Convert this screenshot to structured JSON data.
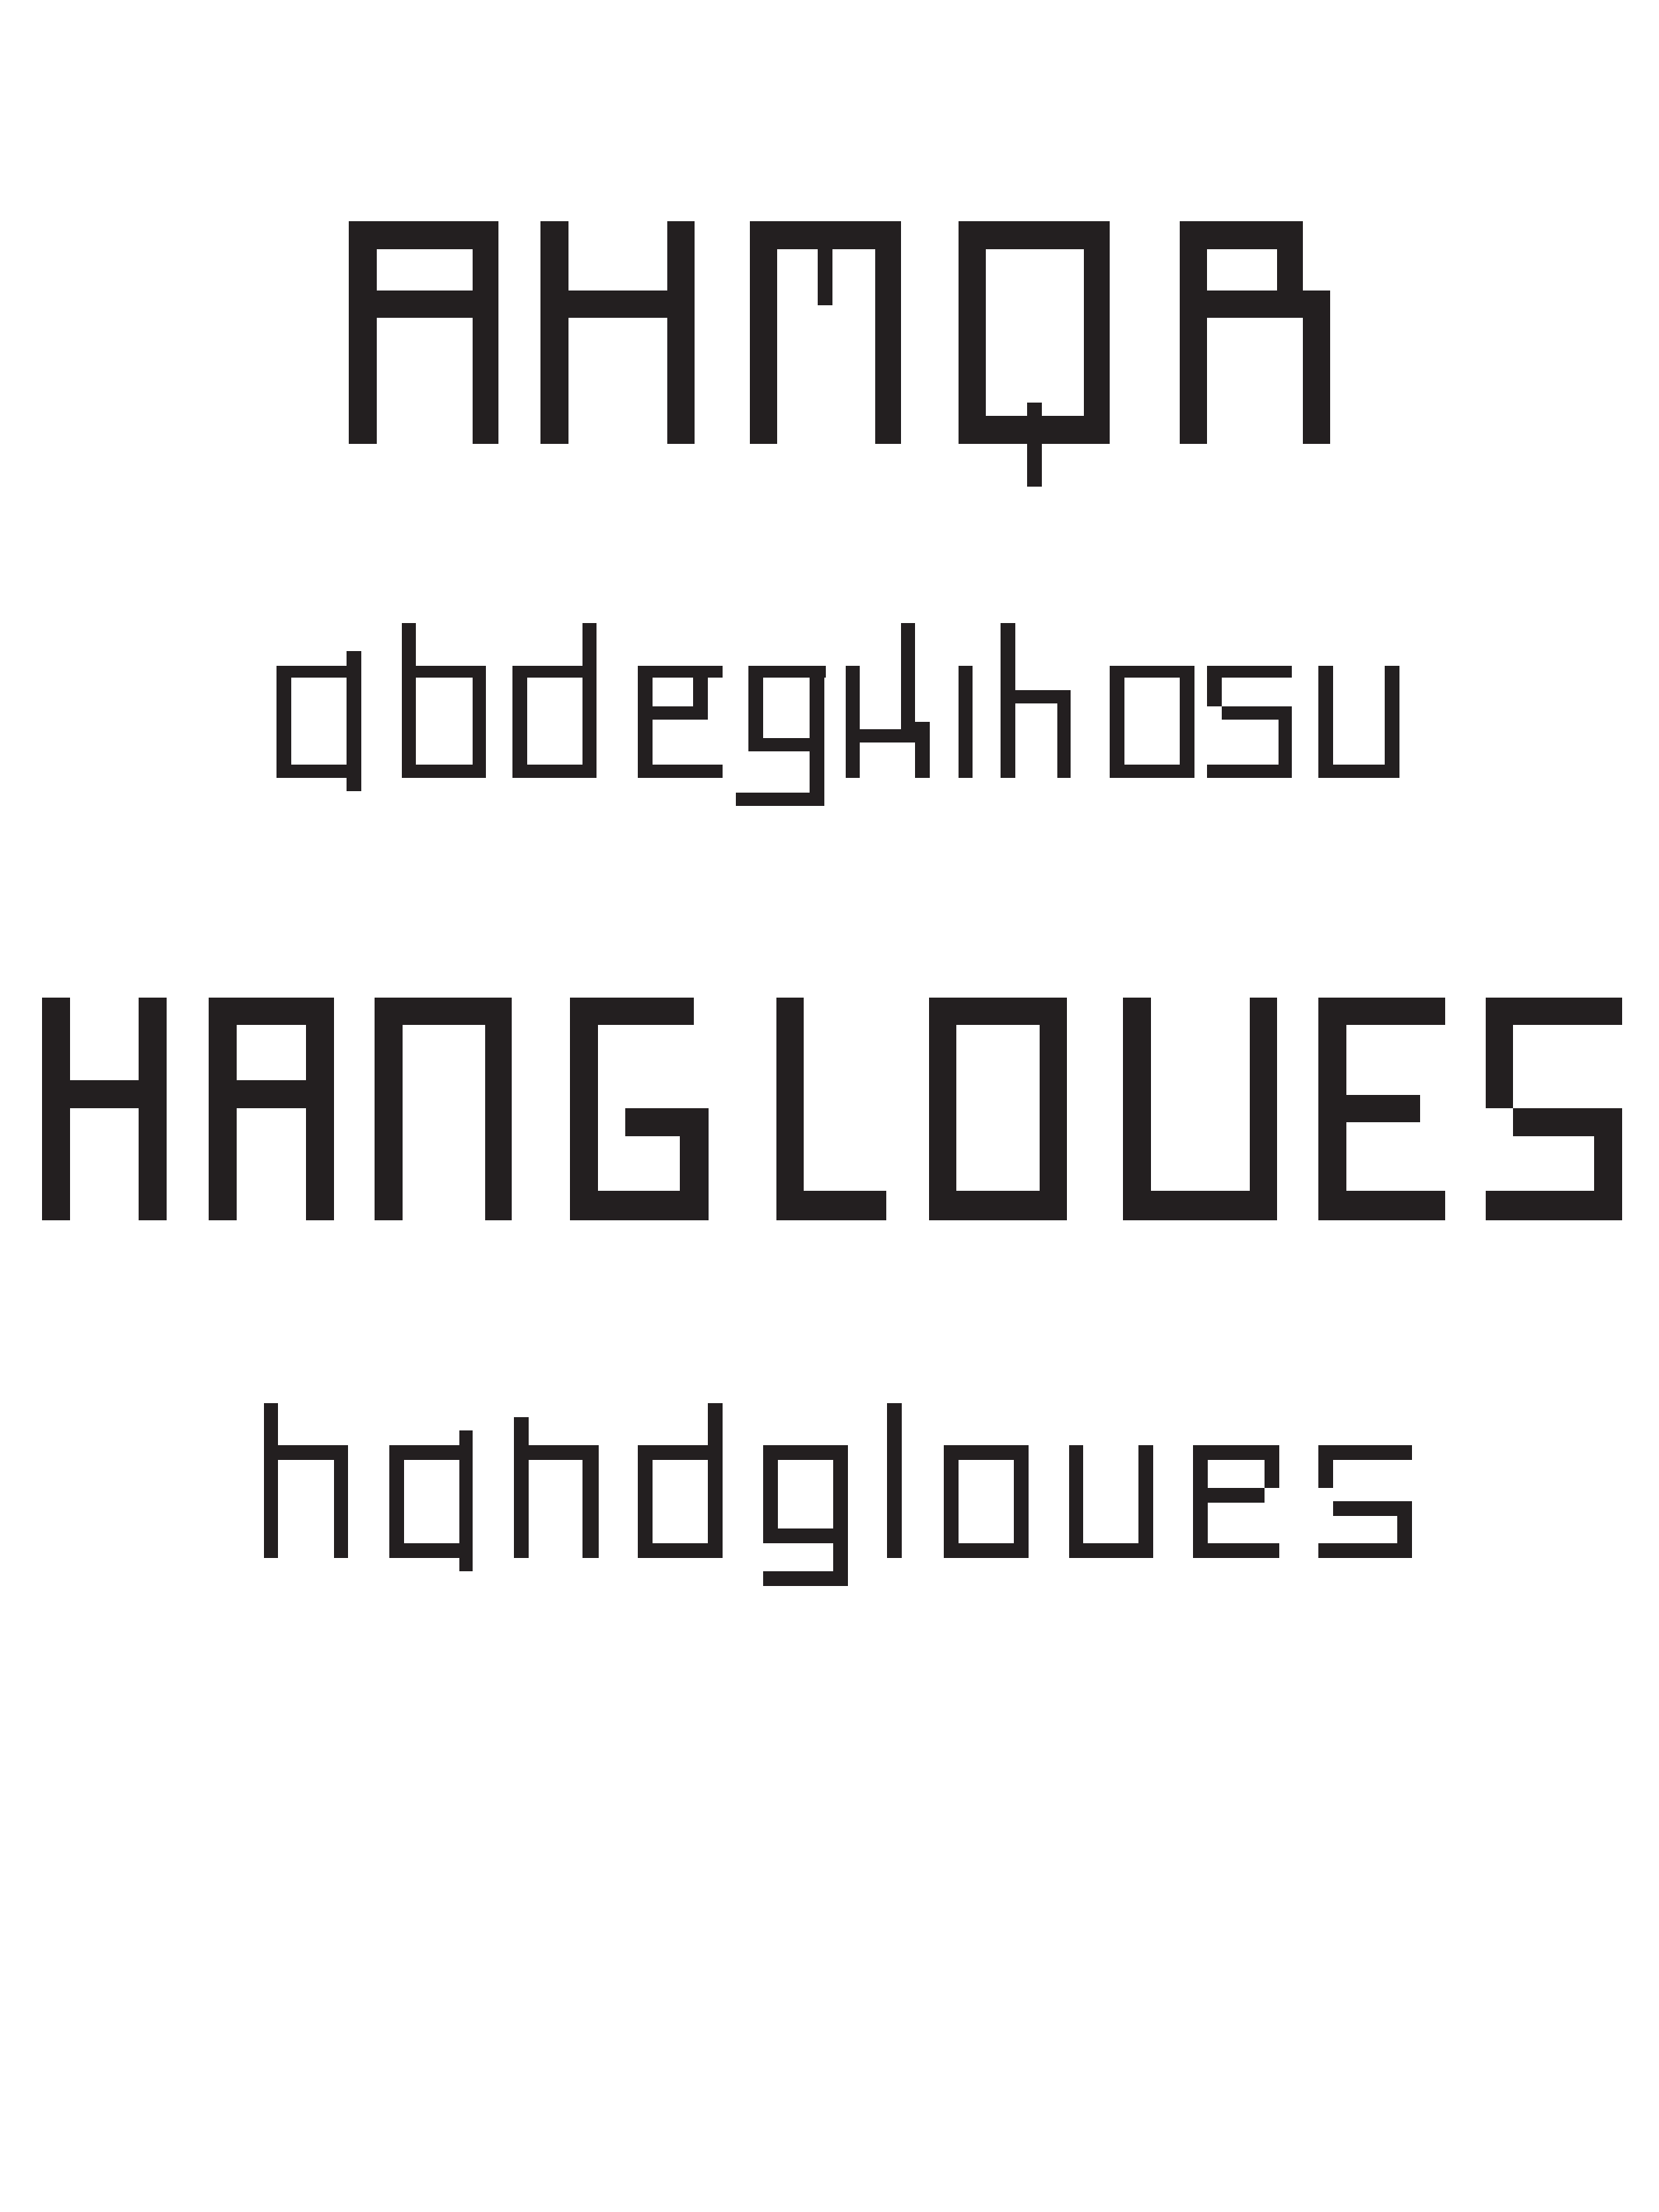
{
  "specimen": {
    "ink_color": "#231f20",
    "background_color": "#ffffff",
    "lines": [
      {
        "id": "uppercase-sample",
        "text": "AHMQR"
      },
      {
        "id": "lowercase-sample",
        "text": "abdegkihosu"
      },
      {
        "id": "uppercase-word",
        "text": "HANGLOVES"
      },
      {
        "id": "lowercase-word",
        "text": "handgloves"
      }
    ]
  }
}
